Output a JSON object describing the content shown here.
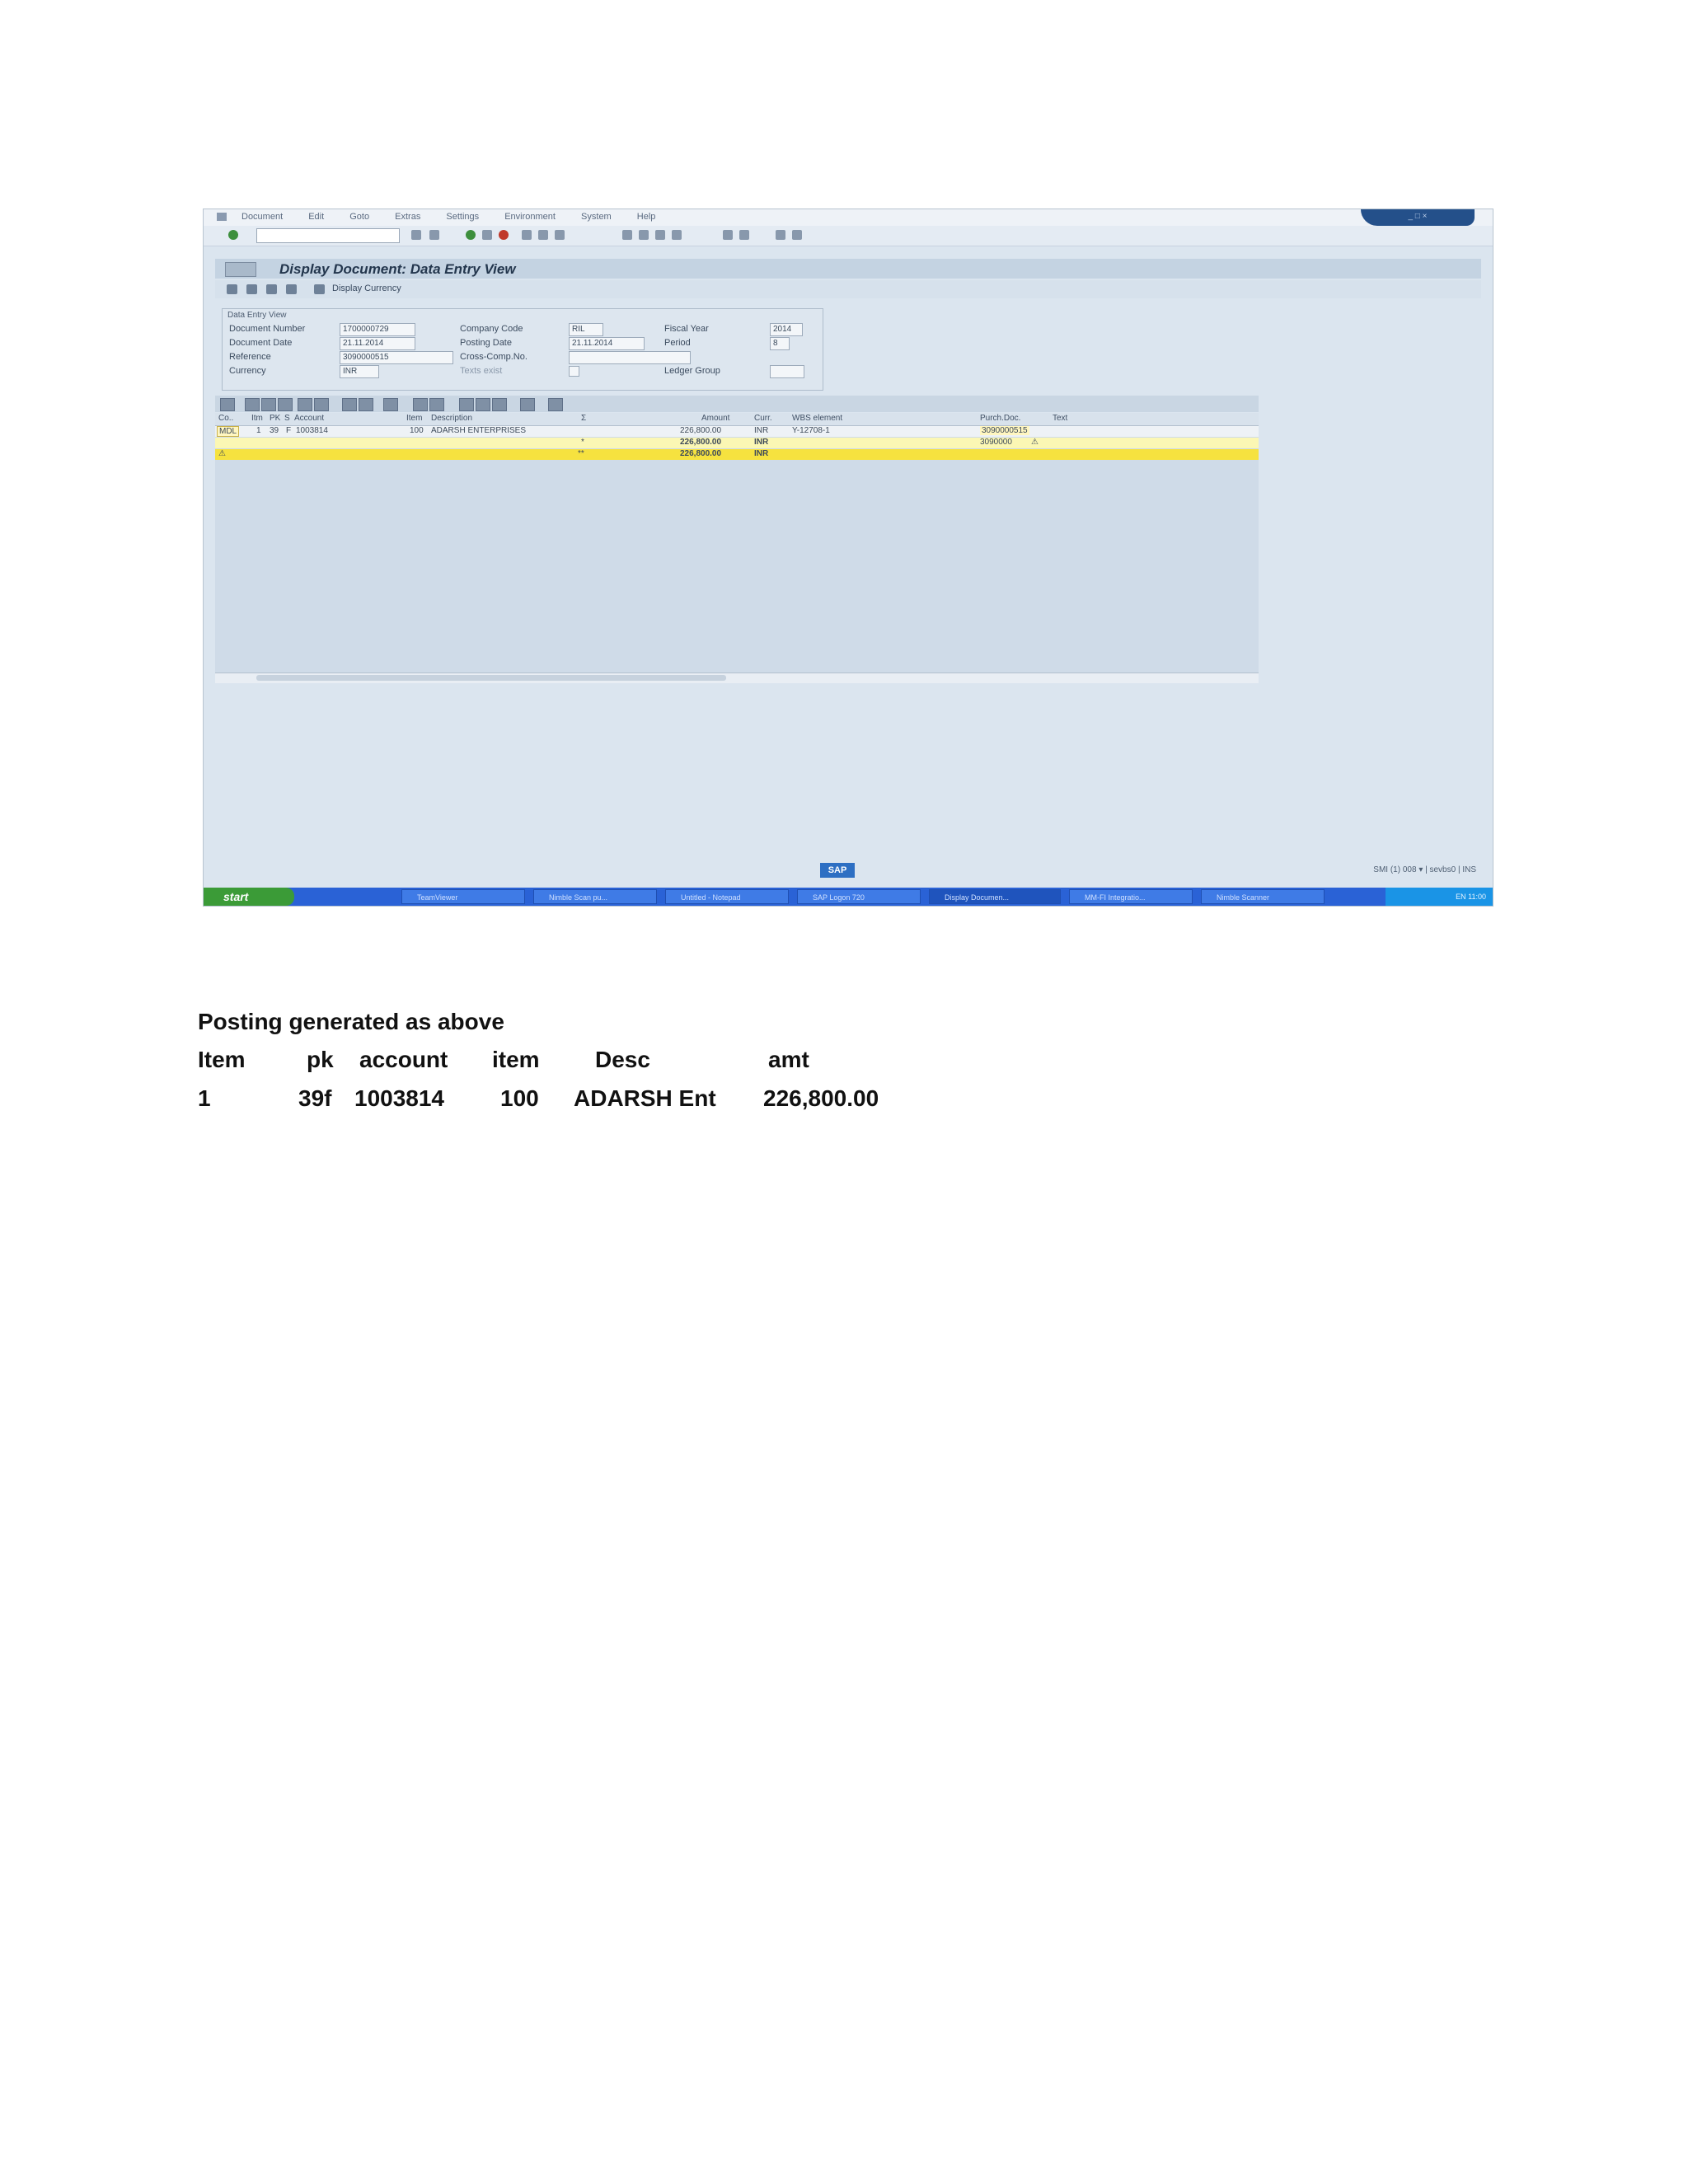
{
  "sap": {
    "menu": [
      "Document",
      "Edit",
      "Goto",
      "Extras",
      "Settings",
      "Environment",
      "System",
      "Help"
    ],
    "title": "Display Document: Data Entry View",
    "app_toolbar_label": "Display Currency",
    "group_title": "Data Entry View",
    "header": {
      "document_number_label": "Document Number",
      "document_number": "1700000729",
      "document_date_label": "Document Date",
      "document_date": "21.11.2014",
      "reference_label": "Reference",
      "reference": "3090000515",
      "currency_label": "Currency",
      "currency": "INR",
      "company_code_label": "Company Code",
      "company_code": "RIL",
      "posting_date_label": "Posting Date",
      "posting_date": "21.11.2014",
      "cross_comp_label": "Cross-Comp.No.",
      "texts_exist_label": "Texts exist",
      "fiscal_year_label": "Fiscal Year",
      "fiscal_year": "2014",
      "period_label": "Period",
      "period": "8",
      "ledger_group_label": "Ledger Group"
    },
    "grid": {
      "columns": [
        "Co..",
        "Itm",
        "PK",
        "S",
        "Account",
        "Item",
        "Description",
        "Σ",
        "Amount",
        "Curr.",
        "WBS element",
        "Purch.Doc.",
        "Text"
      ],
      "row": {
        "co": "MDL",
        "itm": "1",
        "pk": "39",
        "s": "F",
        "account": "1003814",
        "item": "100",
        "description": "ADARSH ENTERPRISES",
        "amount": "226,800.00",
        "curr": "INR",
        "wbs": "Y-12708-1",
        "purch_doc": "3090000515"
      },
      "subtotal": {
        "sigma": "*",
        "amount": "226,800.00",
        "curr": "INR",
        "purch_doc": "3090000"
      },
      "total": {
        "sigma": "**",
        "amount": "226,800.00",
        "curr": "INR"
      }
    },
    "status": "SMI (1) 008 ▾   | sevbs0   | INS",
    "taskbar": {
      "start": "start",
      "tasks": [
        "TeamViewer",
        "Nimble Scan pu...",
        "Untitled - Notepad",
        "SAP Logon 720",
        "Display Documen...",
        "MM-FI Integratio...",
        "Nimble Scanner"
      ],
      "tray": "EN  11:00"
    }
  },
  "notes": {
    "heading": "Posting generated as above",
    "table": {
      "headers": [
        "Item",
        "pk",
        "account",
        "item",
        "Desc",
        "amt"
      ],
      "row": [
        "1",
        "39f",
        "1003814",
        "100",
        "ADARSH Ent",
        "226,800.00"
      ]
    }
  }
}
